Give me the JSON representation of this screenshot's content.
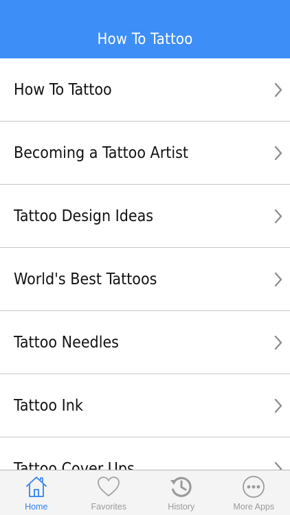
{
  "header": {
    "title": "How To Tattoo"
  },
  "list": {
    "items": [
      {
        "label": "How To Tattoo"
      },
      {
        "label": "Becoming a Tattoo Artist"
      },
      {
        "label": "Tattoo Design Ideas"
      },
      {
        "label": "World's Best Tattoos"
      },
      {
        "label": "Tattoo Needles"
      },
      {
        "label": "Tattoo Ink"
      },
      {
        "label": "Tattoo Cover Ups"
      }
    ]
  },
  "tabs": [
    {
      "label": "Home",
      "icon": "home-icon",
      "active": true
    },
    {
      "label": "Favorites",
      "icon": "heart-icon",
      "active": false
    },
    {
      "label": "History",
      "icon": "history-icon",
      "active": false
    },
    {
      "label": "More Apps",
      "icon": "more-icon",
      "active": false
    }
  ],
  "colors": {
    "accent": "#3d8ef7",
    "tab_active": "#2f80ed",
    "tab_inactive": "#9a9a9a"
  }
}
